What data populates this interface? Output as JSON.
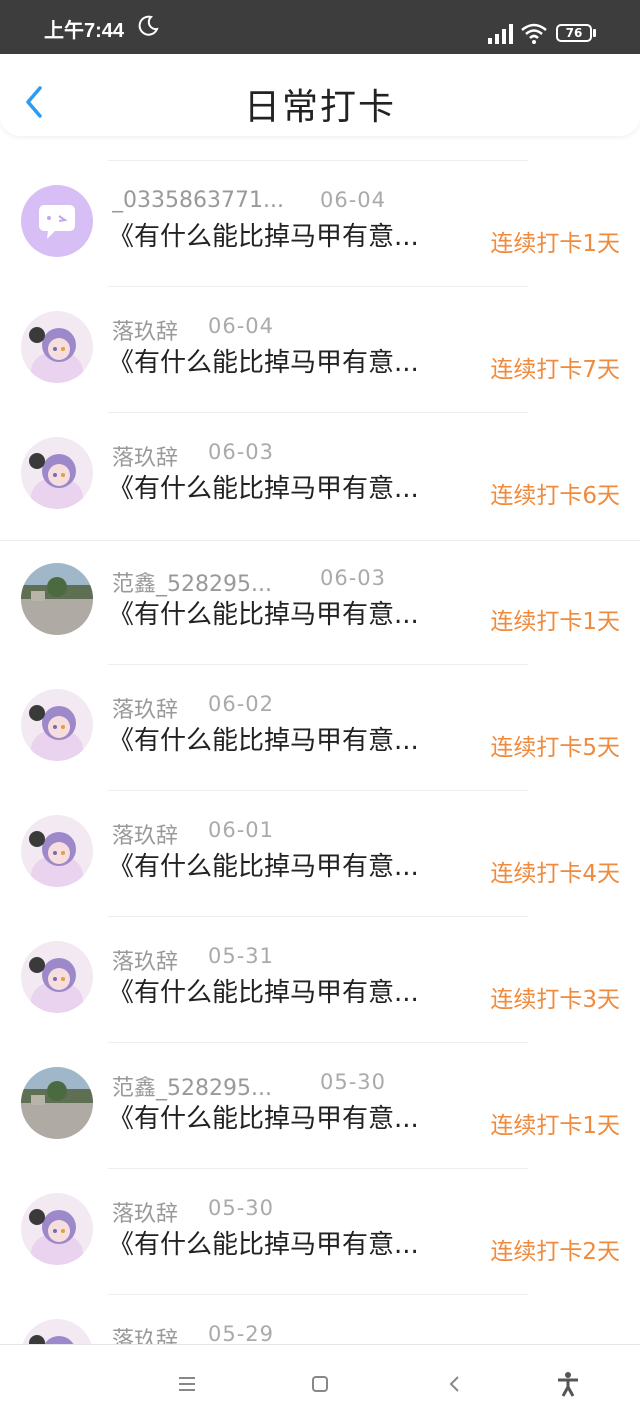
{
  "status": {
    "time": "上午7:44",
    "battery": "76"
  },
  "header": {
    "title": "日常打卡"
  },
  "items": [
    {
      "name": "_0335863771...",
      "date": "06-04",
      "content": "《有什么能比掉马甲有意...",
      "badge": "连续打卡1天",
      "avatar": "chat-avatar"
    },
    {
      "name": "落玖辞",
      "date": "06-04",
      "content": "《有什么能比掉马甲有意...",
      "badge": "连续打卡7天",
      "avatar": "anime-avatar"
    },
    {
      "name": "落玖辞",
      "date": "06-03",
      "content": "《有什么能比掉马甲有意...",
      "badge": "连续打卡6天",
      "avatar": "anime-avatar"
    },
    {
      "name": "范鑫_528295...",
      "date": "06-03",
      "content": "《有什么能比掉马甲有意...",
      "badge": "连续打卡1天",
      "avatar": "photo-avatar"
    },
    {
      "name": "落玖辞",
      "date": "06-02",
      "content": "《有什么能比掉马甲有意...",
      "badge": "连续打卡5天",
      "avatar": "anime-avatar"
    },
    {
      "name": "落玖辞",
      "date": "06-01",
      "content": "《有什么能比掉马甲有意...",
      "badge": "连续打卡4天",
      "avatar": "anime-avatar"
    },
    {
      "name": "落玖辞",
      "date": "05-31",
      "content": "《有什么能比掉马甲有意...",
      "badge": "连续打卡3天",
      "avatar": "anime-avatar"
    },
    {
      "name": "范鑫_528295...",
      "date": "05-30",
      "content": "《有什么能比掉马甲有意...",
      "badge": "连续打卡1天",
      "avatar": "photo-avatar"
    },
    {
      "name": "落玖辞",
      "date": "05-30",
      "content": "《有什么能比掉马甲有意...",
      "badge": "连续打卡2天",
      "avatar": "anime-avatar"
    },
    {
      "name": "落玖辞",
      "date": "05-29",
      "content": "",
      "badge": "",
      "avatar": "anime-avatar"
    }
  ],
  "nav": {
    "icons": [
      "menu-icon",
      "home-icon",
      "back-icon",
      "accessibility-icon"
    ]
  },
  "colors": {
    "accent": "#2b9bf4",
    "badge": "#f08a3c",
    "status_bar": "#3d3d3d"
  }
}
